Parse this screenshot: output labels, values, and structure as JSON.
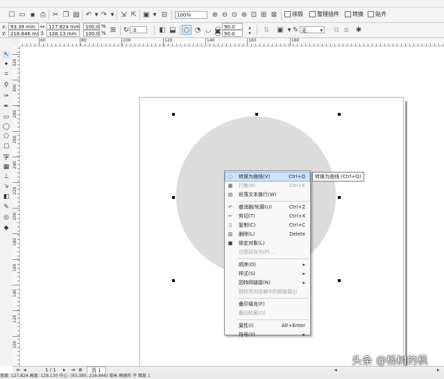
{
  "toolbar": {
    "zoom": "100%",
    "paste_label": "排版",
    "plugin_label": "整理插件",
    "convert_label": "转换",
    "stick_label": "贴齐"
  },
  "properties": {
    "x": "93.38 mm",
    "y": "216.846 mm",
    "width": "127.824 mm",
    "height": "128.13 mm",
    "scale_x": "100.0",
    "scale_y": "100.0",
    "percent": "%",
    "rotation": ".0",
    "angle1": "90.0",
    "angle2": "90.0",
    "outline": "无",
    "x_label": "x:",
    "y_label": "y:"
  },
  "ruler": {
    "h_labels": [
      "60",
      "80",
      "100",
      "120",
      "140",
      "160",
      "180"
    ],
    "v_labels": [
      "320",
      "300",
      "280",
      "260",
      "240",
      "220",
      "200",
      "180",
      "160",
      "140",
      "120",
      "100"
    ]
  },
  "context_menu": {
    "items": [
      {
        "icon": "convert-curve-icon",
        "glyph": "◌",
        "label": "转换为曲线(V)",
        "shortcut": "Ctrl+Q",
        "disabled": false,
        "highlight": true
      },
      {
        "icon": "break-icon",
        "glyph": "▦",
        "label": "打散(B)",
        "shortcut": "Ctrl+K",
        "disabled": true
      },
      {
        "icon": "text-wrap-icon",
        "glyph": "▤",
        "label": "段落文本换行(W)",
        "shortcut": "",
        "disabled": false
      },
      {
        "sep": true
      },
      {
        "icon": "undo-icon",
        "glyph": "↶",
        "label": "撤消删/轮廓(U)",
        "shortcut": "Ctrl+Z",
        "disabled": false
      },
      {
        "icon": "cut-icon",
        "glyph": "✂",
        "label": "剪切(T)",
        "shortcut": "Ctrl+X",
        "disabled": false
      },
      {
        "icon": "copy-icon",
        "glyph": "▯",
        "label": "复制(C)",
        "shortcut": "Ctrl+C",
        "disabled": false
      },
      {
        "icon": "delete-icon",
        "glyph": "▥",
        "label": "删除(L)",
        "shortcut": "Delete",
        "disabled": false
      },
      {
        "icon": "lock-icon",
        "glyph": "■",
        "label": "锁定对象(L)",
        "shortcut": "",
        "disabled": false
      },
      {
        "icon": "",
        "glyph": "",
        "label": "位图另存为(P)...",
        "shortcut": "",
        "disabled": true
      },
      {
        "sep": true
      },
      {
        "icon": "",
        "glyph": "",
        "label": "顺序(O)",
        "shortcut": "▸",
        "disabled": false
      },
      {
        "icon": "",
        "glyph": "",
        "label": "样式(S)",
        "shortcut": "▸",
        "disabled": false
      },
      {
        "icon": "",
        "glyph": "",
        "label": "因特网链接(N)",
        "shortcut": "▸",
        "disabled": false
      },
      {
        "icon": "",
        "glyph": "",
        "label": "跳转到浏览器中的超链接(J)",
        "shortcut": "",
        "disabled": true
      },
      {
        "sep": true
      },
      {
        "icon": "",
        "glyph": "",
        "label": "叠印填充(F)",
        "shortcut": "",
        "disabled": false
      },
      {
        "icon": "",
        "glyph": "",
        "label": "叠印轮廓(O)",
        "shortcut": "",
        "disabled": true
      },
      {
        "sep": true
      },
      {
        "icon": "",
        "glyph": "",
        "label": "属性(I)",
        "shortcut": "Alt+Enter",
        "disabled": false
      },
      {
        "icon": "",
        "glyph": "",
        "label": "符号(Y)",
        "shortcut": "▸",
        "disabled": false
      }
    ]
  },
  "tooltip": "转换为曲线 (Ctrl+Q)",
  "pagebar": {
    "page_count": "1 / 1",
    "page_tab": "页 1"
  },
  "status": "宽度: 127.824 高度: 128.130 中心: (93.380, 216.846) 毫米          椭圆形 于 图层 1",
  "watermark": "头条 @杨树的枫"
}
